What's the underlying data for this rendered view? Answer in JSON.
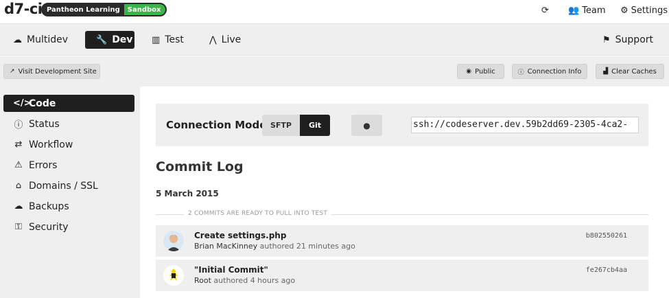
{
  "header": {
    "site_name": "d7-ci",
    "org_name": "Pantheon Learning",
    "plan": "Sandbox",
    "team_label": "Team",
    "settings_label": "Settings"
  },
  "env_tabs": [
    {
      "label": "Multidev",
      "icon": "cloud-icon",
      "active": false
    },
    {
      "label": "Dev",
      "icon": "wrench-icon",
      "active": true
    },
    {
      "label": "Test",
      "icon": "bar-chart-icon",
      "active": false
    },
    {
      "label": "Live",
      "icon": "pulse-icon",
      "active": false
    }
  ],
  "support_label": "Support",
  "actions": {
    "visit_site": "Visit Development Site",
    "public": "Public",
    "connection_info": "Connection Info",
    "clear_caches": "Clear Caches"
  },
  "sidebar": {
    "items": [
      {
        "label": "Code",
        "icon": "code-icon",
        "active": true
      },
      {
        "label": "Status",
        "icon": "info-icon",
        "active": false
      },
      {
        "label": "Workflow",
        "icon": "workflow-icon",
        "active": false
      },
      {
        "label": "Errors",
        "icon": "warning-icon",
        "active": false
      },
      {
        "label": "Domains / SSL",
        "icon": "home-icon",
        "active": false
      },
      {
        "label": "Backups",
        "icon": "cloud-upload-icon",
        "active": false
      },
      {
        "label": "Security",
        "icon": "key-icon",
        "active": false
      }
    ]
  },
  "connection": {
    "label": "Connection Mode:",
    "modes": [
      "SFTP",
      "Git"
    ],
    "active_mode": "Git",
    "ssh_url": "ssh://codeserver.dev.59b2dd69-2305-4ca2-"
  },
  "commit_log": {
    "title": "Commit Log",
    "date": "5 March 2015",
    "ready_text": "2 COMMITS ARE READY TO PULL INTO TEST",
    "commits": [
      {
        "message": "Create settings.php",
        "author": "Brian MacKinney",
        "verb": "authored",
        "time": "21 minutes ago",
        "hash": "b802550261"
      },
      {
        "message": "\"Initial Commit\"",
        "author": "Root",
        "verb": "authored",
        "time": "4 hours ago",
        "hash": "fe267cb4aa"
      }
    ]
  }
}
